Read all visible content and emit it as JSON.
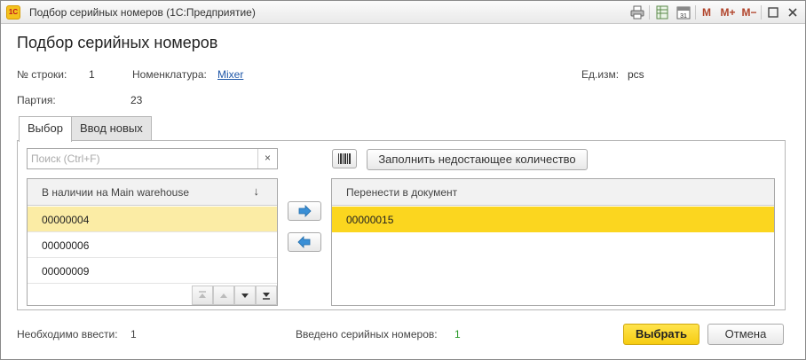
{
  "window": {
    "title": "Подбор серийных номеров  (1С:Предприятие)",
    "logo_text": "1С"
  },
  "titlebar_buttons": {
    "m": "M",
    "m_plus": "M+",
    "m_minus": "M−"
  },
  "form": {
    "title": "Подбор серийных номеров",
    "line_no_label": "№ строки:",
    "line_no_value": "1",
    "item_label": "Номенклатура:",
    "item_value": "Mixer",
    "unit_label": "Ед.изм:",
    "unit_value": "pcs",
    "batch_label": "Партия:",
    "batch_value": "23"
  },
  "tabs": [
    {
      "label": "Выбор",
      "active": true
    },
    {
      "label": "Ввод новых",
      "active": false
    }
  ],
  "search": {
    "placeholder": "Поиск (Ctrl+F)",
    "value": "",
    "clear_glyph": "×"
  },
  "fill_button_label": "Заполнить недостающее количество",
  "available_table": {
    "header": "В наличии на Main warehouse",
    "sort_glyph": "↓",
    "rows": [
      "00000004",
      "00000006",
      "00000009"
    ],
    "selected_index": 0
  },
  "document_table": {
    "header": "Перенести в документ",
    "rows": [
      "00000015"
    ],
    "current_index": 0
  },
  "footer": {
    "required_label": "Необходимо ввести:",
    "required_value": "1",
    "entered_label": "Введено серийных номеров:",
    "entered_value": "1",
    "entered_color": "#2a9a2a"
  },
  "buttons": {
    "select": "Выбрать",
    "cancel": "Отмена"
  },
  "colors": {
    "accent_yellow": "#f6cc12",
    "row_selected": "#fbeca5",
    "row_current": "#fbd61f",
    "link": "#1f57a8"
  }
}
